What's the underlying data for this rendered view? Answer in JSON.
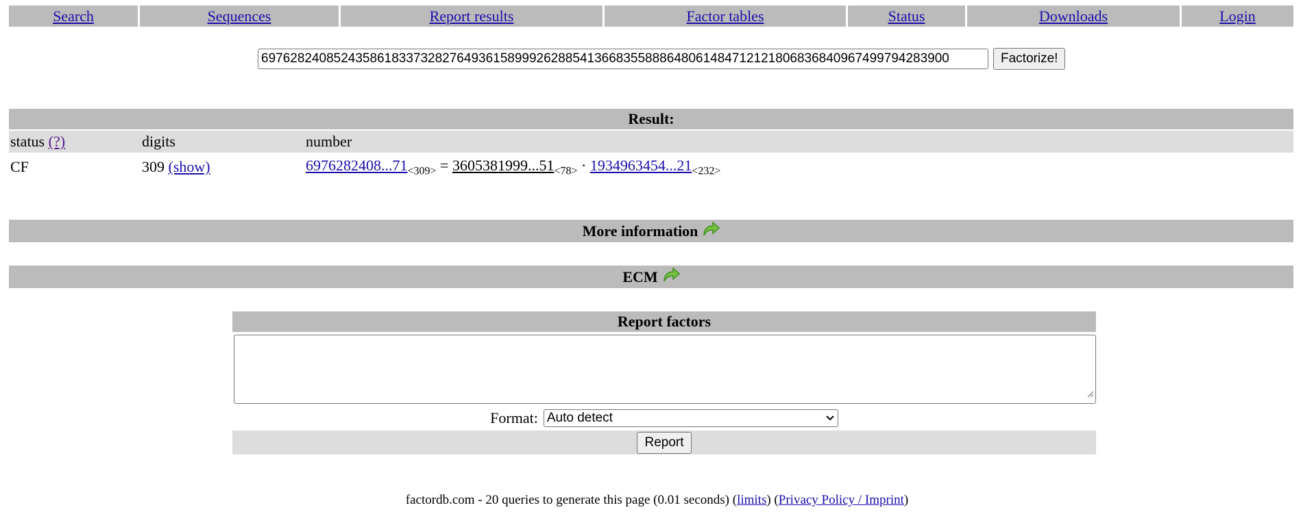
{
  "nav": [
    "Search",
    "Sequences",
    "Report results",
    "Factor tables",
    "Status",
    "Downloads",
    "Login"
  ],
  "search": {
    "value": "69762824085243586183373282764936158999262885413668355888648061484712121806836840967499794283900",
    "button": "Factorize!"
  },
  "result": {
    "heading": "Result:",
    "headers": {
      "status": "status",
      "status_help": "(?)",
      "digits": "digits",
      "number": "number"
    },
    "row": {
      "status": "CF",
      "digits": "309",
      "show": "(show)",
      "number": "6976282408...71",
      "number_digits": "<309>",
      "equals": "=",
      "factor1": "3605381999...51",
      "factor1_digits": "<78>",
      "dot": "·",
      "factor2": "1934963454...21",
      "factor2_digits": "<232>"
    }
  },
  "sections": {
    "more_info": "More information",
    "ecm": "ECM"
  },
  "report": {
    "heading": "Report factors",
    "format_label": "Format:",
    "format_value": "Auto detect",
    "button": "Report"
  },
  "footer": {
    "text": "factordb.com - 20 queries to generate this page (0.01 seconds) (",
    "limits": "limits",
    "mid": ") (",
    "privacy": "Privacy Policy / Imprint",
    "end": ")"
  }
}
